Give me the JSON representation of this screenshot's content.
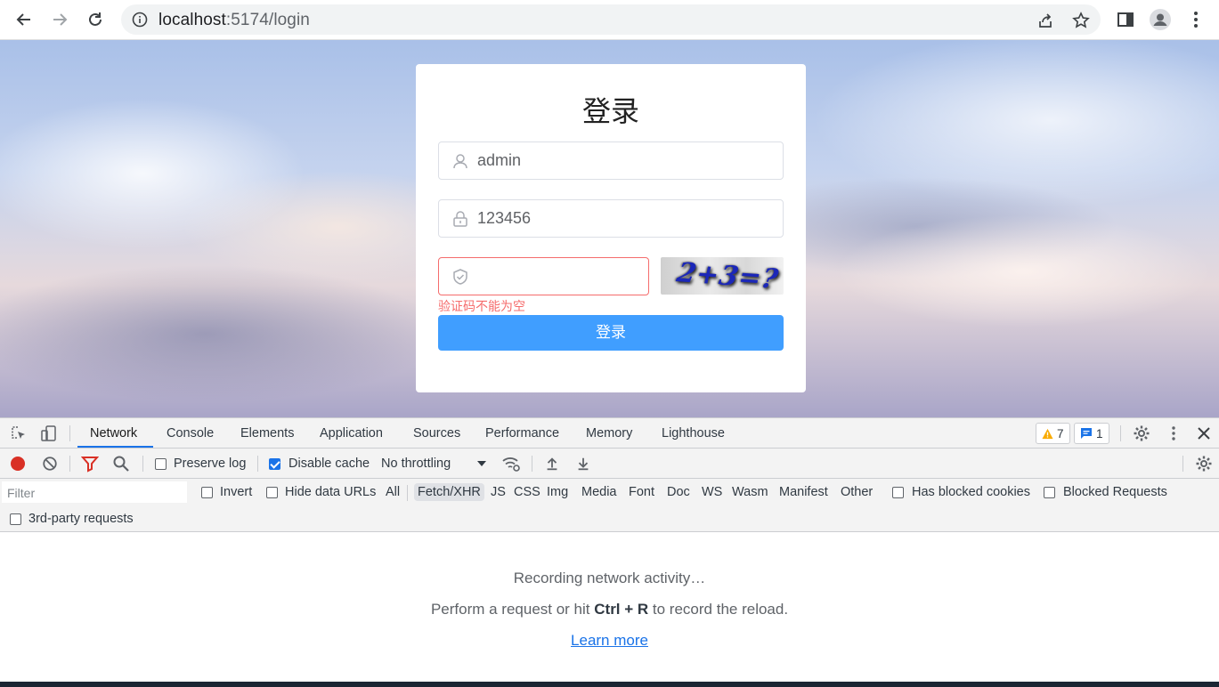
{
  "browser": {
    "url_host": "localhost",
    "url_path": ":5174/login"
  },
  "login": {
    "title": "登录",
    "username_value": "admin",
    "password_value": "123456",
    "captcha_value": "",
    "captcha_image_text": "2+3=?",
    "captcha_error": "验证码不能为空",
    "submit_label": "登录"
  },
  "devtools": {
    "tabs": [
      "Network",
      "Console",
      "Elements",
      "Application",
      "Sources",
      "Performance",
      "Memory",
      "Lighthouse"
    ],
    "active_tab": "Network",
    "warning_count": "7",
    "message_count": "1",
    "toolbar": {
      "preserve_log": "Preserve log",
      "disable_cache": "Disable cache",
      "throttling": "No throttling"
    },
    "filter": {
      "placeholder": "Filter",
      "invert": "Invert",
      "hide_data_urls": "Hide data URLs",
      "types": [
        "All",
        "Fetch/XHR",
        "JS",
        "CSS",
        "Img",
        "Media",
        "Font",
        "Doc",
        "WS",
        "Wasm",
        "Manifest",
        "Other"
      ],
      "selected_type": "Fetch/XHR",
      "has_blocked_cookies": "Has blocked cookies",
      "blocked_requests": "Blocked Requests",
      "third_party": "3rd-party requests"
    },
    "empty": {
      "line1": "Recording network activity…",
      "line2_prefix": "Perform a request or hit ",
      "line2_keys": "Ctrl + R",
      "line2_suffix": " to record the reload.",
      "learn_more": "Learn more"
    }
  },
  "colors": {
    "primary": "#409eff",
    "error": "#f56c6c",
    "devtools_accent": "#1a73e8",
    "record_red": "#d93025"
  }
}
